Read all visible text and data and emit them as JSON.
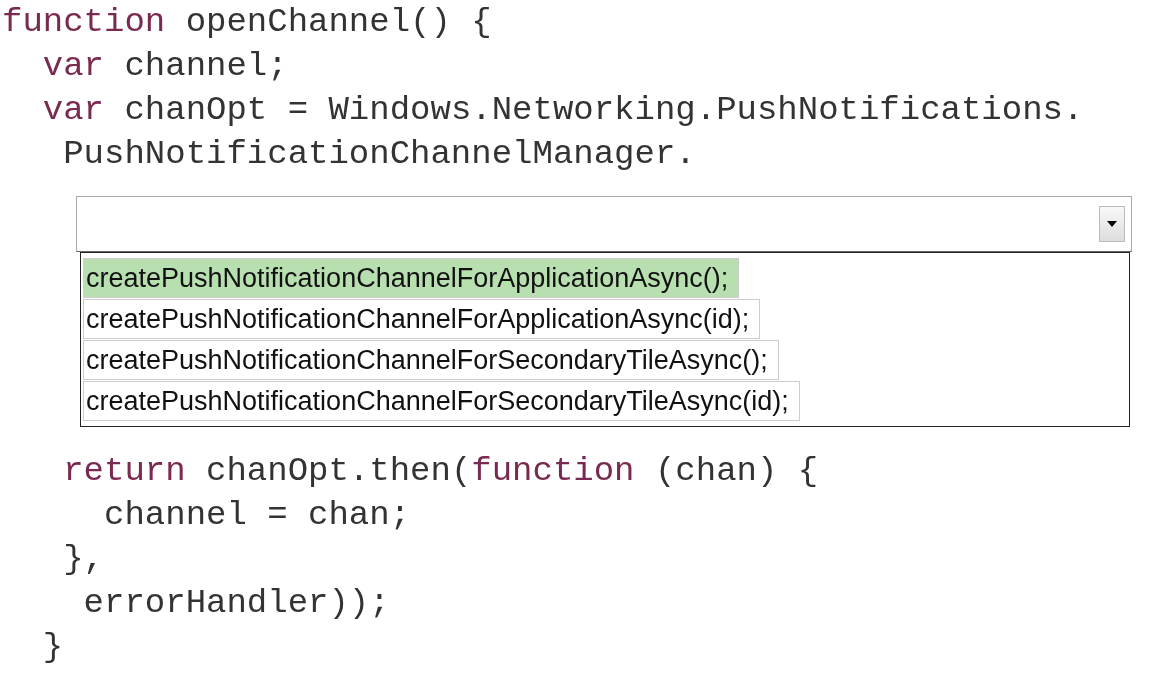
{
  "code_before": [
    {
      "parts": [
        {
          "kind": "keyword",
          "text": "function"
        },
        {
          "kind": "plain",
          "text": " openChannel() {"
        }
      ]
    },
    {
      "parts": [
        {
          "kind": "keyword",
          "text": "  var"
        },
        {
          "kind": "plain",
          "text": " channel;"
        }
      ]
    },
    {
      "parts": [
        {
          "kind": "keyword",
          "text": "  var"
        },
        {
          "kind": "plain",
          "text": " chanOpt = Windows.Networking.PushNotifications."
        }
      ]
    },
    {
      "parts": [
        {
          "kind": "plain",
          "text": "   PushNotificationChannelManager."
        }
      ]
    }
  ],
  "dropdown": {
    "options": [
      {
        "label": "createPushNotificationChannelForApplicationAsync();",
        "selected": true
      },
      {
        "label": "createPushNotificationChannelForApplicationAsync(id);",
        "selected": false
      },
      {
        "label": "createPushNotificationChannelForSecondaryTileAsync();",
        "selected": false
      },
      {
        "label": "createPushNotificationChannelForSecondaryTileAsync(id);",
        "selected": false
      }
    ]
  },
  "code_after": [
    {
      "parts": [
        {
          "kind": "keyword",
          "text": "   return"
        },
        {
          "kind": "plain",
          "text": " chanOpt.then("
        },
        {
          "kind": "keyword",
          "text": "function"
        },
        {
          "kind": "plain",
          "text": " (chan) {"
        }
      ]
    },
    {
      "parts": [
        {
          "kind": "plain",
          "text": "     channel = chan;"
        }
      ]
    },
    {
      "parts": [
        {
          "kind": "plain",
          "text": "   },"
        }
      ]
    },
    {
      "parts": [
        {
          "kind": "plain",
          "text": "    errorHandler));"
        }
      ]
    },
    {
      "parts": [
        {
          "kind": "plain",
          "text": "  }"
        }
      ]
    }
  ]
}
